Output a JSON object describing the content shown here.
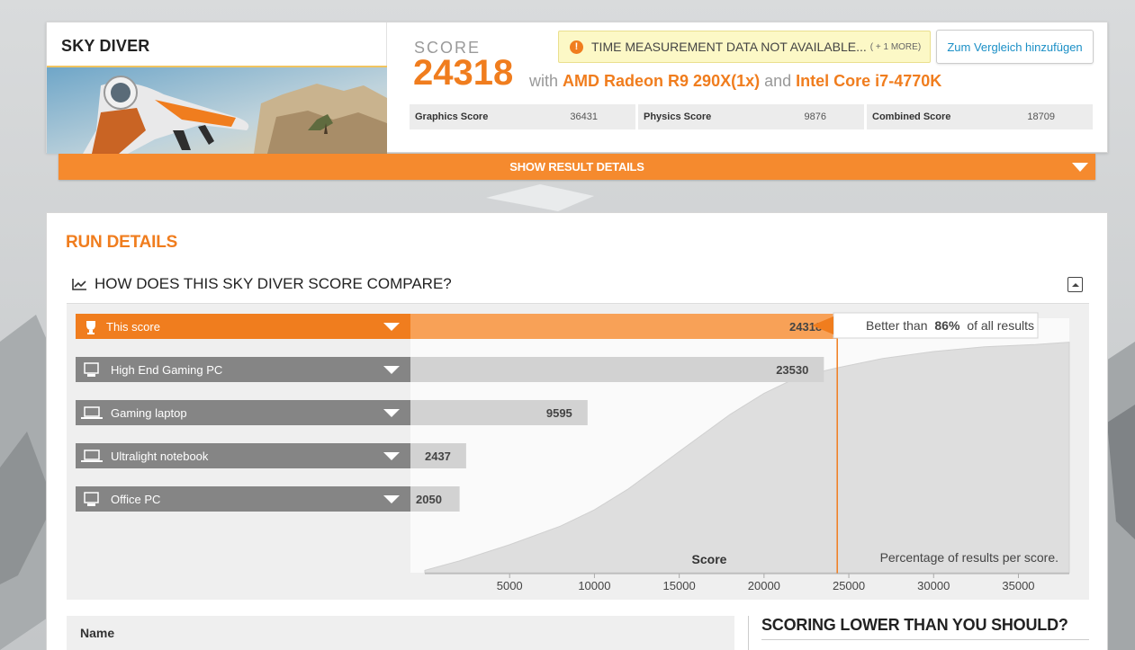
{
  "top": {
    "benchmark_title": "SKY DIVER",
    "score_label": "SCORE",
    "score_value": "24318",
    "with_text": "with",
    "gpu": "AMD Radeon R9 290X(1x)",
    "and_text": "and",
    "cpu": "Intel Core i7-4770K",
    "warning_text": "TIME MEASUREMENT DATA NOT AVAILABLE...",
    "warning_more": "( + 1 MORE)",
    "warning_icon": "!",
    "compare_button": "Zum Vergleich hinzufügen",
    "sub_scores": [
      {
        "label": "Graphics Score",
        "value": "36431"
      },
      {
        "label": "Physics Score",
        "value": "9876"
      },
      {
        "label": "Combined Score",
        "value": "18709"
      }
    ],
    "details_bar": "SHOW RESULT DETAILS"
  },
  "run": {
    "title": "RUN DETAILS",
    "compare_heading": "HOW DOES THIS SKY DIVER SCORE COMPARE?",
    "better_than_prefix": "Better than",
    "better_than_pct": "86%",
    "better_than_suffix": "of all results",
    "chart_axis_label": "Score",
    "chart_note": "Percentage of results per score.",
    "name_header": "Name",
    "scoring_lower": "SCORING LOWER THAN YOU SHOULD?"
  },
  "colors": {
    "accent": "#f07d1e",
    "accent_light": "#f8a157",
    "gray_label": "#858585",
    "gray_bar": "#d2d2d2",
    "curve": "#dedede"
  },
  "chart_data": {
    "type": "bar",
    "categories": [
      "This score",
      "High End Gaming PC",
      "Gaming laptop",
      "Ultralight notebook",
      "Office PC"
    ],
    "icons": [
      "trophy-icon",
      "desktop-icon",
      "laptop-icon",
      "laptop-icon",
      "desktop-icon"
    ],
    "values": [
      24318,
      23530,
      9595,
      2437,
      2050
    ],
    "xlabel": "Score",
    "xticks": [
      5000,
      10000,
      15000,
      20000,
      25000,
      30000,
      35000
    ],
    "xlim": [
      0,
      38000
    ],
    "marker_value": 24318,
    "distribution_curve": {
      "x": [
        0,
        2000,
        5000,
        8000,
        10000,
        12000,
        15000,
        18000,
        20000,
        22000,
        24318,
        27000,
        30000,
        33000,
        36000,
        38000
      ],
      "y": [
        1,
        5,
        12,
        20,
        27,
        36,
        52,
        68,
        77,
        84,
        88,
        92,
        95,
        97,
        98,
        99
      ]
    }
  }
}
